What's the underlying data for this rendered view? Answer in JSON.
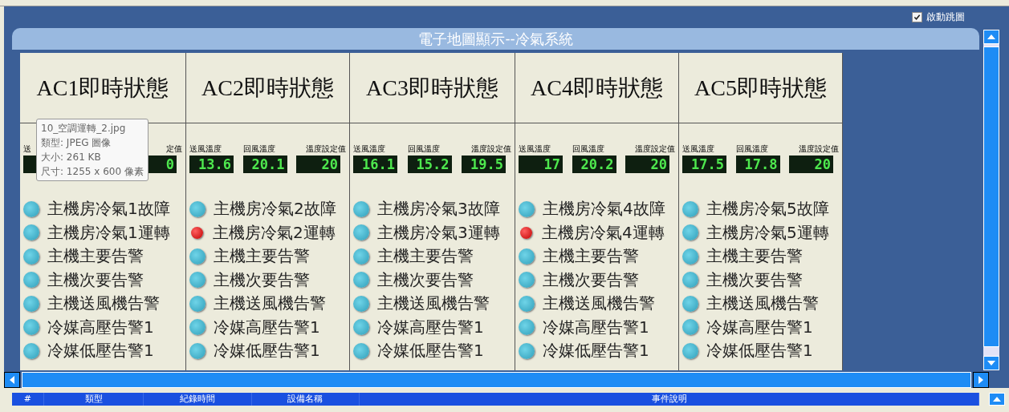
{
  "auto_jump": {
    "label": "啟動跳圖",
    "checked": true
  },
  "panel": {
    "title": "電子地圖顯示--冷氣系統"
  },
  "units": [
    {
      "title": "AC1即時狀態",
      "sensors": [
        {
          "label": "送"
        },
        {
          "label": "定值",
          "value": "0"
        }
      ],
      "alarms": [
        {
          "label": "主機房冷氣1故障",
          "active": false
        },
        {
          "label": "主機房冷氣1運轉",
          "active": false
        },
        {
          "label": "主機主要告警",
          "active": false
        },
        {
          "label": "主機次要告警",
          "active": false
        },
        {
          "label": "主機送風機告警",
          "active": false
        },
        {
          "label": "冷媒高壓告警1",
          "active": false
        },
        {
          "label": "冷媒低壓告警1",
          "active": false
        }
      ]
    },
    {
      "title": "AC2即時狀態",
      "sensors": [
        {
          "label": "送風溫度",
          "value": "13.6"
        },
        {
          "label": "回風溫度",
          "value": "20.1"
        },
        {
          "label": "溫度設定值",
          "value": "20"
        }
      ],
      "alarms": [
        {
          "label": "主機房冷氣2故障",
          "active": false
        },
        {
          "label": "主機房冷氣2運轉",
          "active": true
        },
        {
          "label": "主機主要告警",
          "active": false
        },
        {
          "label": "主機次要告警",
          "active": false
        },
        {
          "label": "主機送風機告警",
          "active": false
        },
        {
          "label": "冷媒高壓告警1",
          "active": false
        },
        {
          "label": "冷媒低壓告警1",
          "active": false
        }
      ]
    },
    {
      "title": "AC3即時狀態",
      "sensors": [
        {
          "label": "送風溫度",
          "value": "16.1"
        },
        {
          "label": "回風溫度",
          "value": "15.2"
        },
        {
          "label": "溫度設定值",
          "value": "19.5"
        }
      ],
      "alarms": [
        {
          "label": "主機房冷氣3故障",
          "active": false
        },
        {
          "label": "主機房冷氣3運轉",
          "active": false
        },
        {
          "label": "主機主要告警",
          "active": false
        },
        {
          "label": "主機次要告警",
          "active": false
        },
        {
          "label": "主機送風機告警",
          "active": false
        },
        {
          "label": "冷媒高壓告警1",
          "active": false
        },
        {
          "label": "冷媒低壓告警1",
          "active": false
        }
      ]
    },
    {
      "title": "AC4即時狀態",
      "sensors": [
        {
          "label": "送風溫度",
          "value": "17"
        },
        {
          "label": "回風溫度",
          "value": "20.2"
        },
        {
          "label": "溫度設定值",
          "value": "20"
        }
      ],
      "alarms": [
        {
          "label": "主機房冷氣4故障",
          "active": false
        },
        {
          "label": "主機房冷氣4運轉",
          "active": true
        },
        {
          "label": "主機主要告警",
          "active": false
        },
        {
          "label": "主機次要告警",
          "active": false
        },
        {
          "label": "主機送風機告警",
          "active": false
        },
        {
          "label": "冷媒高壓告警1",
          "active": false
        },
        {
          "label": "冷媒低壓告警1",
          "active": false
        }
      ]
    },
    {
      "title": "AC5即時狀態",
      "sensors": [
        {
          "label": "送風溫度",
          "value": "17.5"
        },
        {
          "label": "回風溫度",
          "value": "17.8"
        },
        {
          "label": "溫度設定值",
          "value": "20"
        }
      ],
      "alarms": [
        {
          "label": "主機房冷氣5故障",
          "active": false
        },
        {
          "label": "主機房冷氣5運轉",
          "active": false
        },
        {
          "label": "主機主要告警",
          "active": false
        },
        {
          "label": "主機次要告警",
          "active": false
        },
        {
          "label": "主機送風機告警",
          "active": false
        },
        {
          "label": "冷媒高壓告警1",
          "active": false
        },
        {
          "label": "冷媒低壓告警1",
          "active": false
        }
      ]
    }
  ],
  "tooltip": {
    "lines": [
      "10_空調運轉_2.jpg",
      "類型: JPEG 圖像",
      "大小: 261 KB",
      "尺寸: 1255 x 600 像素"
    ]
  },
  "event_table": {
    "columns": [
      "#",
      "類型",
      "紀錄時間",
      "設備名稱",
      "事件說明"
    ]
  }
}
